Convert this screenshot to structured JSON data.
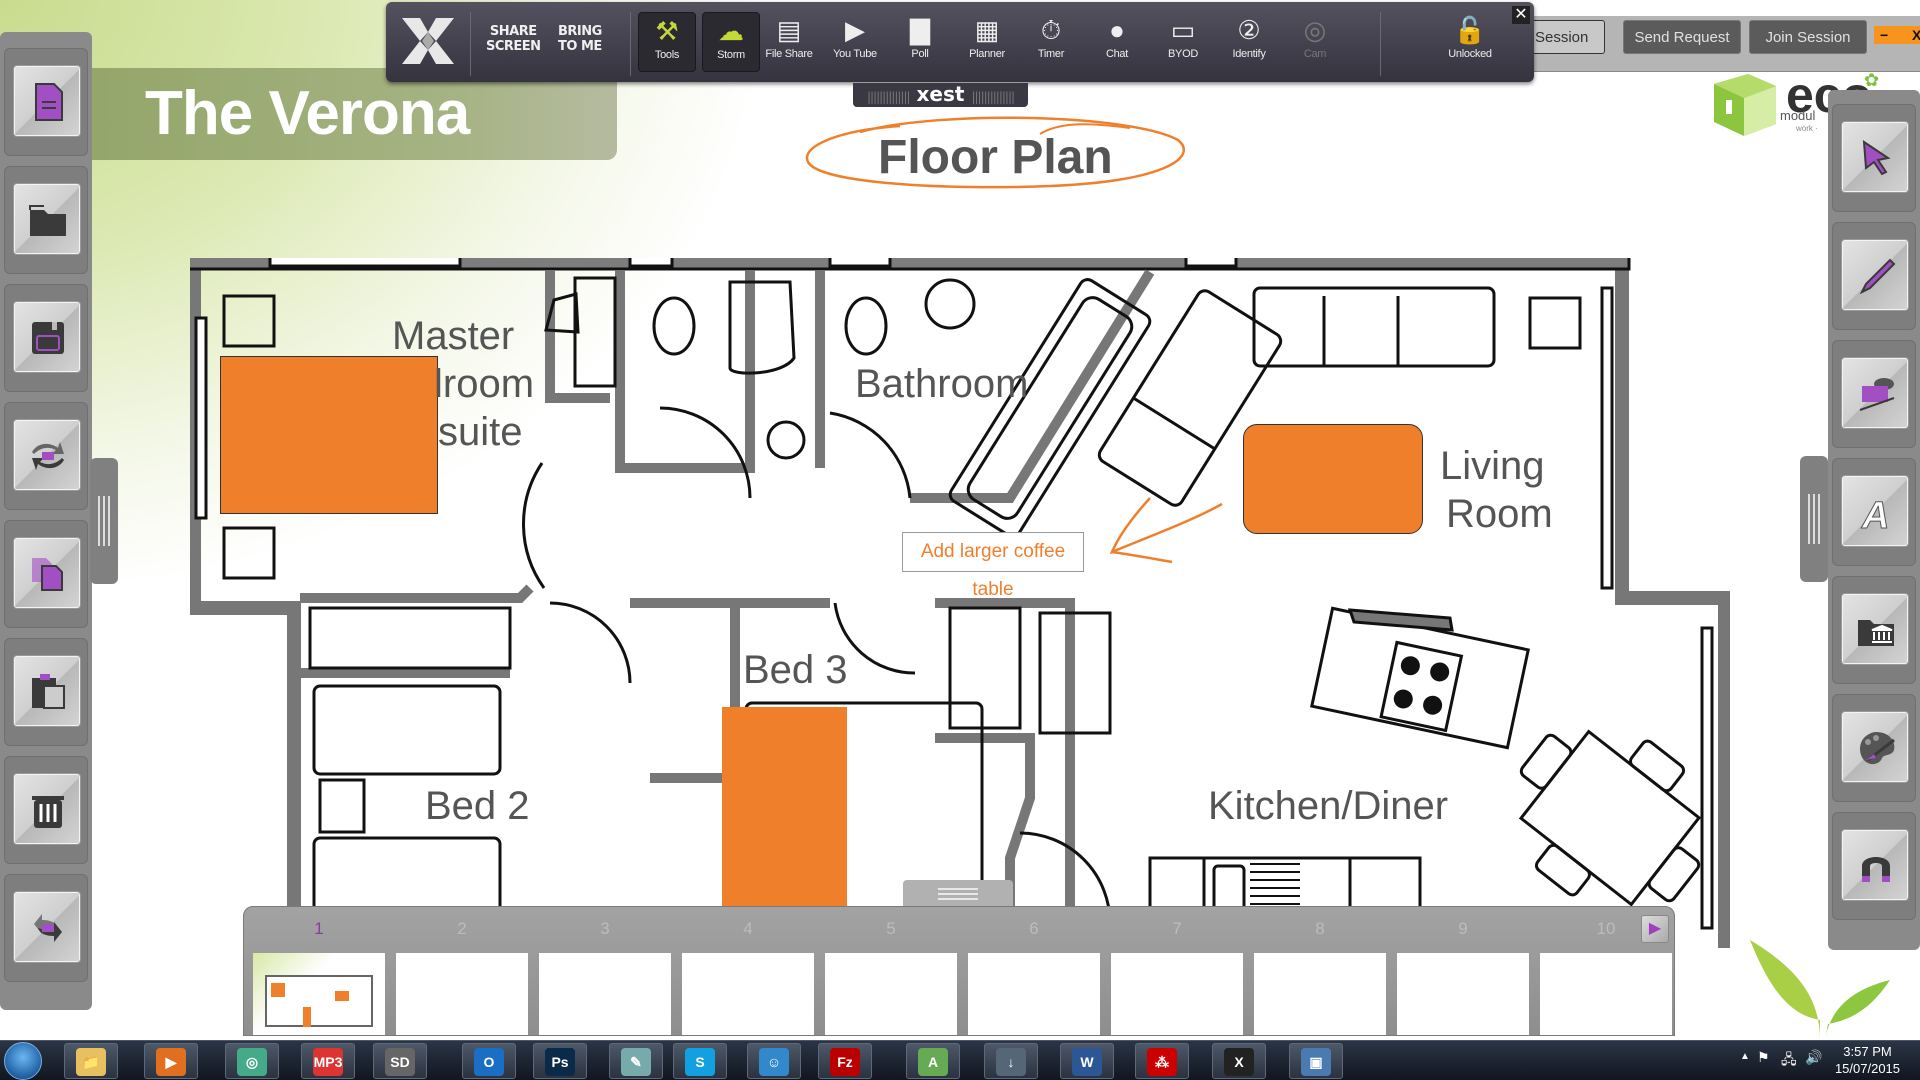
{
  "slide": {
    "title": "The Verona",
    "subtitle": "Floor Plan",
    "rooms": [
      {
        "id": "master",
        "label": "Master\nbedroom\nen suite",
        "visible_text": [
          "Master",
          "lroom",
          "suite"
        ]
      },
      {
        "id": "bathroom",
        "label": "Bathroom"
      },
      {
        "id": "living",
        "label_line1": "Living",
        "label_line2": "Room"
      },
      {
        "id": "bed3",
        "label": "Bed 3"
      },
      {
        "id": "bed2",
        "label": "Bed 2"
      },
      {
        "id": "kitchen",
        "label": "Kitchen/Diner"
      }
    ],
    "annotation": "Add larger coffee table",
    "highlight_color": "#F07F2C",
    "logo": {
      "brand": "eco",
      "tagline": "modul",
      "subtag": "work ·"
    }
  },
  "session_bar": {
    "partial_button": "Session",
    "send_request": "Send Request",
    "join_session": "Join Session",
    "minimize": "−",
    "close": "X",
    "accent": "#F7941D"
  },
  "toolbar": {
    "share_screen": "SHARE\nSCREEN",
    "share_line1": "SHARE",
    "share_line2": "SCREEN",
    "bring_line1": "BRING",
    "bring_line2": "TO ME",
    "items": [
      {
        "label": "Tools",
        "icon": "tools-icon",
        "state": "active"
      },
      {
        "label": "Storm",
        "icon": "storm-icon",
        "state": "active"
      },
      {
        "label": "File Share",
        "icon": "file-share-icon",
        "state": "normal"
      },
      {
        "label": "You Tube",
        "icon": "youtube-icon",
        "state": "normal"
      },
      {
        "label": "Poll",
        "icon": "poll-icon",
        "state": "normal"
      },
      {
        "label": "Planner",
        "icon": "planner-icon",
        "state": "normal"
      },
      {
        "label": "Timer",
        "icon": "timer-icon",
        "state": "normal"
      },
      {
        "label": "Chat",
        "icon": "chat-icon",
        "state": "normal"
      },
      {
        "label": "BYOD",
        "icon": "byod-icon",
        "state": "normal"
      },
      {
        "label": "Identify",
        "icon": "identify-icon",
        "state": "normal"
      },
      {
        "label": "Cam",
        "icon": "cam-icon",
        "state": "disabled"
      }
    ],
    "lock_label": "Unlocked",
    "close": "✕",
    "handle_label": "xest",
    "accent": "#C5D83A"
  },
  "left_sidebar": [
    {
      "icon": "new-page-icon"
    },
    {
      "icon": "open-folder-icon"
    },
    {
      "icon": "save-icon"
    },
    {
      "icon": "import-export-icon"
    },
    {
      "icon": "duplicate-icon"
    },
    {
      "icon": "clipboard-icon"
    },
    {
      "icon": "trash-icon"
    },
    {
      "icon": "sync-icon"
    }
  ],
  "right_sidebar": [
    {
      "icon": "select-pointer-icon"
    },
    {
      "icon": "pen-icon"
    },
    {
      "icon": "highlighter-shapes-icon"
    },
    {
      "icon": "text-icon",
      "glyph": "A"
    },
    {
      "icon": "resource-library-icon"
    },
    {
      "icon": "palette-icon"
    },
    {
      "icon": "magnet-icon"
    }
  ],
  "pages": {
    "numbers": [
      "1",
      "2",
      "3",
      "4",
      "5",
      "6",
      "7",
      "8",
      "9",
      "10"
    ],
    "active": "1",
    "next": "▶"
  },
  "taskbar": {
    "apps": [
      {
        "name": "file-explorer",
        "glyph": "📁"
      },
      {
        "name": "media-player",
        "glyph": "▶"
      },
      {
        "name": "chrome",
        "glyph": "◎"
      },
      {
        "name": "mp3-app",
        "glyph": "MP3"
      },
      {
        "name": "sd-app",
        "glyph": "SD"
      },
      {
        "name": "outlook",
        "glyph": "O"
      },
      {
        "name": "photoshop",
        "glyph": "Ps"
      },
      {
        "name": "notepad",
        "glyph": "✎"
      },
      {
        "name": "skype",
        "glyph": "S"
      },
      {
        "name": "worker-app",
        "glyph": "☺"
      },
      {
        "name": "filezilla",
        "glyph": "Fz"
      },
      {
        "name": "android-studio",
        "glyph": "A"
      },
      {
        "name": "android-download",
        "glyph": "↓"
      },
      {
        "name": "word",
        "glyph": "W"
      },
      {
        "name": "acrobat",
        "glyph": "⁂"
      },
      {
        "name": "xest",
        "glyph": "X"
      },
      {
        "name": "photo-viewer",
        "glyph": "▣"
      }
    ],
    "clock_time": "3:57 PM",
    "clock_date": "15/07/2015",
    "tray_icons": [
      "show-hidden-icon",
      "action-center-flag-icon",
      "network-icon",
      "volume-icon"
    ]
  }
}
